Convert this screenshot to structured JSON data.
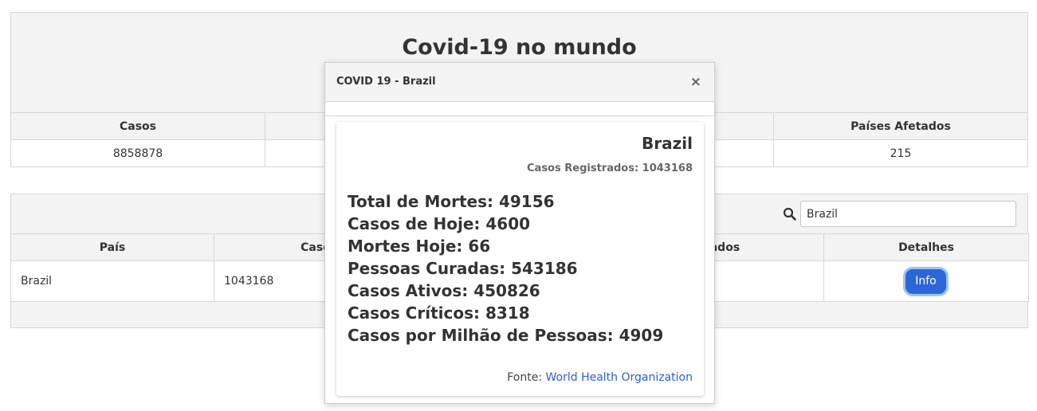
{
  "page": {
    "title": "Covid-19 no mundo"
  },
  "summary": {
    "headers": [
      "Casos",
      "",
      "",
      "Países Afetados"
    ],
    "values": [
      "8858878",
      "",
      "",
      "215"
    ]
  },
  "countries": {
    "search_value": "Brazil",
    "headers": [
      "País",
      "Caso",
      "",
      "rados",
      "Detalhes"
    ],
    "rows": [
      {
        "country": "Brazil",
        "cases": "1043168",
        "info_label": "Info"
      }
    ]
  },
  "modal": {
    "title": "COVID 19 - Brazil",
    "close_glyph": "×",
    "country": "Brazil",
    "cases_line": "Casos Registrados: 1043168",
    "stats": [
      "Total de Mortes: 49156",
      "Casos de Hoje: 4600",
      "Mortes Hoje: 66",
      "Pessoas Curadas: 543186",
      "Casos Ativos: 450826",
      "Casos Críticos: 8318",
      "Casos por Milhão de Pessoas: 4909"
    ],
    "source_prefix": "Fonte: ",
    "source_link": "World Health Organization"
  },
  "colors": {
    "accent": "#2d66d8",
    "link": "#2d5fd0",
    "panel": "#f3f3f3"
  }
}
